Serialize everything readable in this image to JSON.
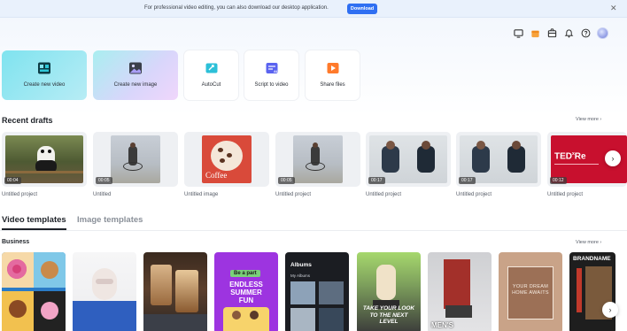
{
  "banner": {
    "text": "For professional video editing, you can also download our desktop application.",
    "button": "Download"
  },
  "create": {
    "new_video": "Create new video",
    "new_image": "Create new image",
    "autocut": "AutoCut",
    "script": "Script to video",
    "share": "Share files"
  },
  "drafts": {
    "title": "Recent drafts",
    "view_more": "View more",
    "items": [
      {
        "name": "Untitled project",
        "duration": "00:04"
      },
      {
        "name": "Untitled",
        "duration": "00:05"
      },
      {
        "name": "Untitled image",
        "duration": ""
      },
      {
        "name": "Untitled project",
        "duration": "00:05"
      },
      {
        "name": "Untitled project",
        "duration": "00:17"
      },
      {
        "name": "Untitled project",
        "duration": "00:17"
      },
      {
        "name": "Untitled project",
        "duration": "00:12"
      }
    ]
  },
  "tabs": {
    "video": "Video templates",
    "image": "Image templates"
  },
  "business": {
    "title": "Business",
    "view_more": "View more",
    "t4_tag": "Be a part",
    "t4_line1": "ENDLESS",
    "t4_line2": "SUMMER",
    "t4_line3": "FUN",
    "t5_title": "Albums",
    "t5_sub": "My Albums",
    "t6_caption": "TAKE YOUR LOOK TO THE NEXT LEVEL",
    "t7_caption": "MEN'S",
    "t8_caption": "YOUR DREAM HOME AWAITS",
    "t9_caption": "BRANDNAME"
  },
  "colors": {
    "accent": "#2f6ff2",
    "text": "#1f2329"
  }
}
